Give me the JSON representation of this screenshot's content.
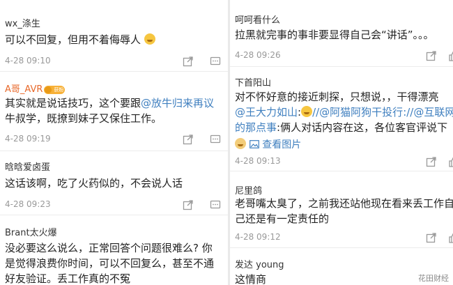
{
  "left": [
    {
      "name": "wx_涤生",
      "lines": [
        "可以不回复，但用不着侮辱人"
      ],
      "time": "4-28 09:10"
    },
    {
      "name": "A哥_AVR",
      "badge": "获粉",
      "line1a": "其实就是说话技巧，这个要跟",
      "line1b": "@放牛归来再议",
      "line2": "牛叔学，既撩到妹子又保住工作。",
      "time": "4-28 09:19"
    },
    {
      "name": "晗晗爱卤蛋",
      "lines": [
        "这话该啊，吃了火药似的，不会说人话"
      ],
      "time": "4-28 09:23"
    },
    {
      "name": "Brant太火爆",
      "lines": [
        "没必要这么说么，正常回答个问题很难么? 你",
        "是觉得浪费你时间，可以不回复么，甚至不通",
        "好友验证。丢工作真的不冤"
      ]
    }
  ],
  "right": [
    {
      "name": "呵呵看什么",
      "lines": [
        "拉黑就完事的事非要显得自己会“讲话”。。。"
      ],
      "time": "4-28 09:26"
    },
    {
      "name": "下首阳山",
      "line1": "对不怀好意的接近刺探，只想说，，干得漂亮",
      "line2_mention1": "@王大力如山",
      "line2_mid": ":",
      "line2_mention2": "//@阿猫阿狗干投行",
      "line2_mention3": "://@互联网",
      "line3a": "的那点事",
      "line3b": ":俩人对话内容在这，各位客官评说下",
      "image_link": "查看图片",
      "time": "4-28 09:13"
    },
    {
      "name": "尼里鸽",
      "lines": [
        "老哥嘴太臭了，之前我还站他现在看来丢工作自",
        "己还是有一定责任的"
      ],
      "time": "4-28 09:12"
    },
    {
      "name": "发达 young",
      "lines": [
        "这情商"
      ]
    }
  ],
  "watermark": "花田财经"
}
